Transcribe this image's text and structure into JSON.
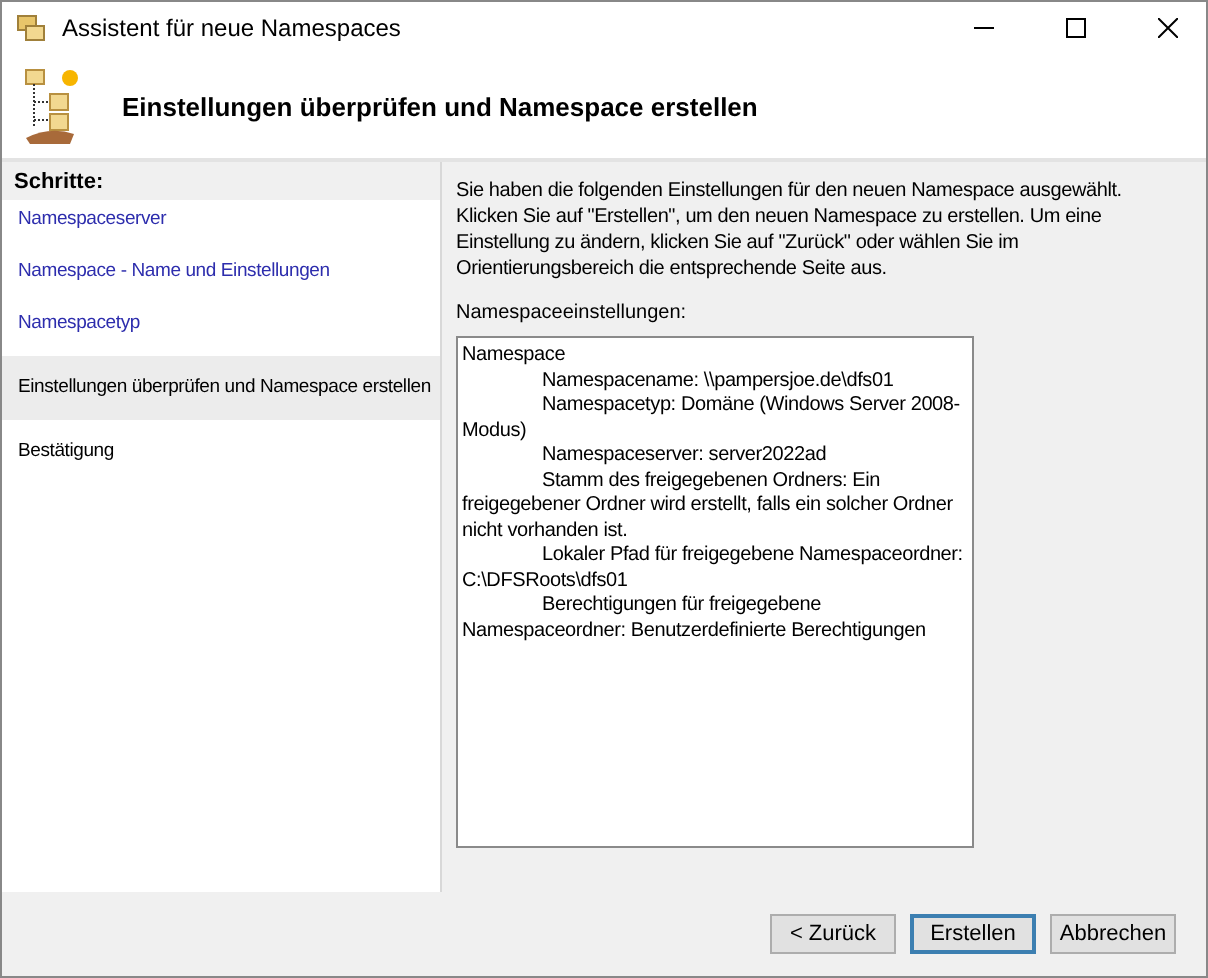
{
  "window": {
    "title": "Assistent für neue Namespaces"
  },
  "header": {
    "title": "Einstellungen überprüfen und Namespace erstellen"
  },
  "steps_title": "Schritte:",
  "steps": [
    {
      "label": "Namespaceserver",
      "completed": true,
      "selected": false
    },
    {
      "label": "Namespace - Name und Einstellungen",
      "completed": true,
      "selected": false
    },
    {
      "label": "Namespacetyp",
      "completed": true,
      "selected": false
    },
    {
      "label": "Einstellungen überprüfen und Namespace erstellen",
      "completed": false,
      "selected": true
    },
    {
      "label": "Bestätigung",
      "completed": false,
      "selected": false
    }
  ],
  "intro": "Sie haben die folgenden Einstellungen für den neuen Namespace ausgewählt. Klicken Sie auf \"Erstellen\", um den neuen Namespace zu erstellen. Um eine Einstellung zu ändern, klicken Sie auf \"Zurück\" oder wählen Sie im Orientierungsbereich die entsprechende Seite aus.",
  "settings_label": "Namespaceeinstellungen:",
  "settings": [
    {
      "kind": "heading",
      "text": "Namespace"
    },
    {
      "kind": "entry",
      "text": "Namespacename: \\\\pampersjoe.de\\dfs01"
    },
    {
      "kind": "entry",
      "text": "Namespacetyp:  Domäne (Windows Server 2008-Modus)"
    },
    {
      "kind": "entry",
      "text": "Namespaceserver: server2022ad"
    },
    {
      "kind": "entry",
      "text": "Stamm des freigegebenen Ordners:  Ein freigegebener Ordner wird erstellt, falls ein solcher Ordner nicht vorhanden ist."
    },
    {
      "kind": "entry",
      "text": "Lokaler Pfad für freigegebene Namespaceordner: C:\\DFSRoots\\dfs01"
    },
    {
      "kind": "entry",
      "text": "Berechtigungen für freigegebene Namespaceordner: Benutzerdefinierte Berechtigungen"
    }
  ],
  "buttons": [
    {
      "label": "< Zurück",
      "selected": false
    },
    {
      "label": "Erstellen",
      "selected": true
    },
    {
      "label": "Abbrechen",
      "selected": false
    }
  ]
}
